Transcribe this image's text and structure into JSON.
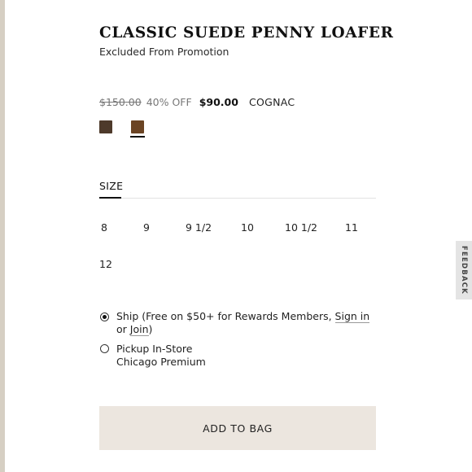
{
  "product": {
    "title": "CLASSIC SUEDE PENNY LOAFER",
    "promo_note": "Excluded From Promotion"
  },
  "pricing": {
    "original": "$150.00",
    "discount": "40% OFF",
    "sale": "$90.00",
    "color_name": "COGNAC"
  },
  "swatches": [
    {
      "color": "#4e3a2b",
      "selected": false
    },
    {
      "color": "#6b4424",
      "selected": true
    }
  ],
  "size_section": {
    "tab_label": "SIZE",
    "options": [
      "8",
      "9",
      "9 1/2",
      "10",
      "10 1/2",
      "11",
      "12"
    ]
  },
  "fulfillment": {
    "selected": "ship",
    "ship": {
      "prefix": "Ship (Free on $50+ for Rewards Members, ",
      "sign_in": "Sign in",
      "middle": " or ",
      "join": "Join",
      "suffix": ")"
    },
    "pickup": {
      "label": "Pickup In-Store",
      "store": "Chicago Premium"
    }
  },
  "add_to_bag": "ADD TO BAG",
  "feedback": "FEEDBACK",
  "colors": {
    "button_bg": "#ece6df",
    "rail": "#d6cfc3"
  }
}
